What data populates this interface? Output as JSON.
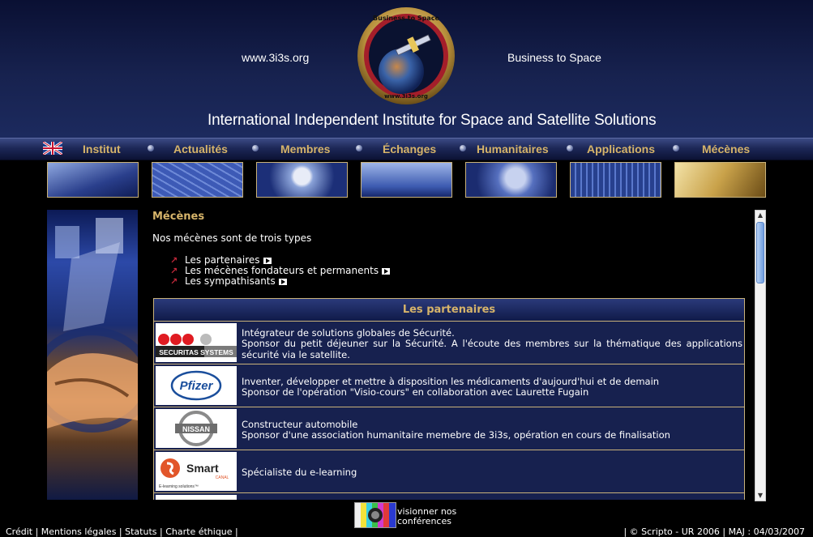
{
  "header": {
    "url": "www.3i3s.org",
    "tagline": "Business to Space",
    "title": "International Independent Institute for Space and Satellite Solutions",
    "logo_top": "Business to Space",
    "logo_bottom": "www.3i3s.org"
  },
  "nav": {
    "flag_icon": "uk-flag-icon",
    "items": [
      "Institut",
      "Actualités",
      "Membres",
      "Échanges",
      "Humanitaires",
      "Applications",
      "Mécènes"
    ]
  },
  "main": {
    "section_title": "Mécènes",
    "intro": "Nos mécènes sont de trois types",
    "links": [
      "Les partenaires",
      "Les mécènes fondateurs et permanents",
      "Les sympathisants"
    ],
    "table_title": "Les partenaires",
    "partners": [
      {
        "logo": "SECURITAS SYSTEMS",
        "lines": [
          "Intégrateur de solutions globales de Sécurité.",
          "Sponsor du petit déjeuner sur la Sécurité. A l'écoute des membres sur la thématique des applications sécurité via le satellite."
        ]
      },
      {
        "logo": "Pfizer",
        "lines": [
          "Inventer, développer et mettre à disposition les médicaments d'aujourd'hui et de demain",
          "Sponsor de l'opération \"Visio-cours\" en collaboration avec Laurette Fugain"
        ]
      },
      {
        "logo": "NISSAN",
        "lines": [
          "Constructeur automobile",
          "Sponsor d'une association humanitaire memebre de 3i3s, opération en cours de finalisation"
        ]
      },
      {
        "logo": "Smart",
        "logo_sub": "CANAL",
        "logo_tag": "E-learning solutions™",
        "lines": [
          "Spécialiste du e-learning"
        ]
      }
    ]
  },
  "footer": {
    "video_line1": "visionner nos",
    "video_line2": "conférences",
    "links": [
      "Crédit",
      "Mentions légales",
      "Statuts",
      "Charte éthique"
    ],
    "right": "| © Scripto - UR 2006 | MAJ : 04/03/2007"
  },
  "colors": {
    "accent_gold": "#d6b46a",
    "navy": "#17214f",
    "arrow_red": "#c2283a"
  }
}
